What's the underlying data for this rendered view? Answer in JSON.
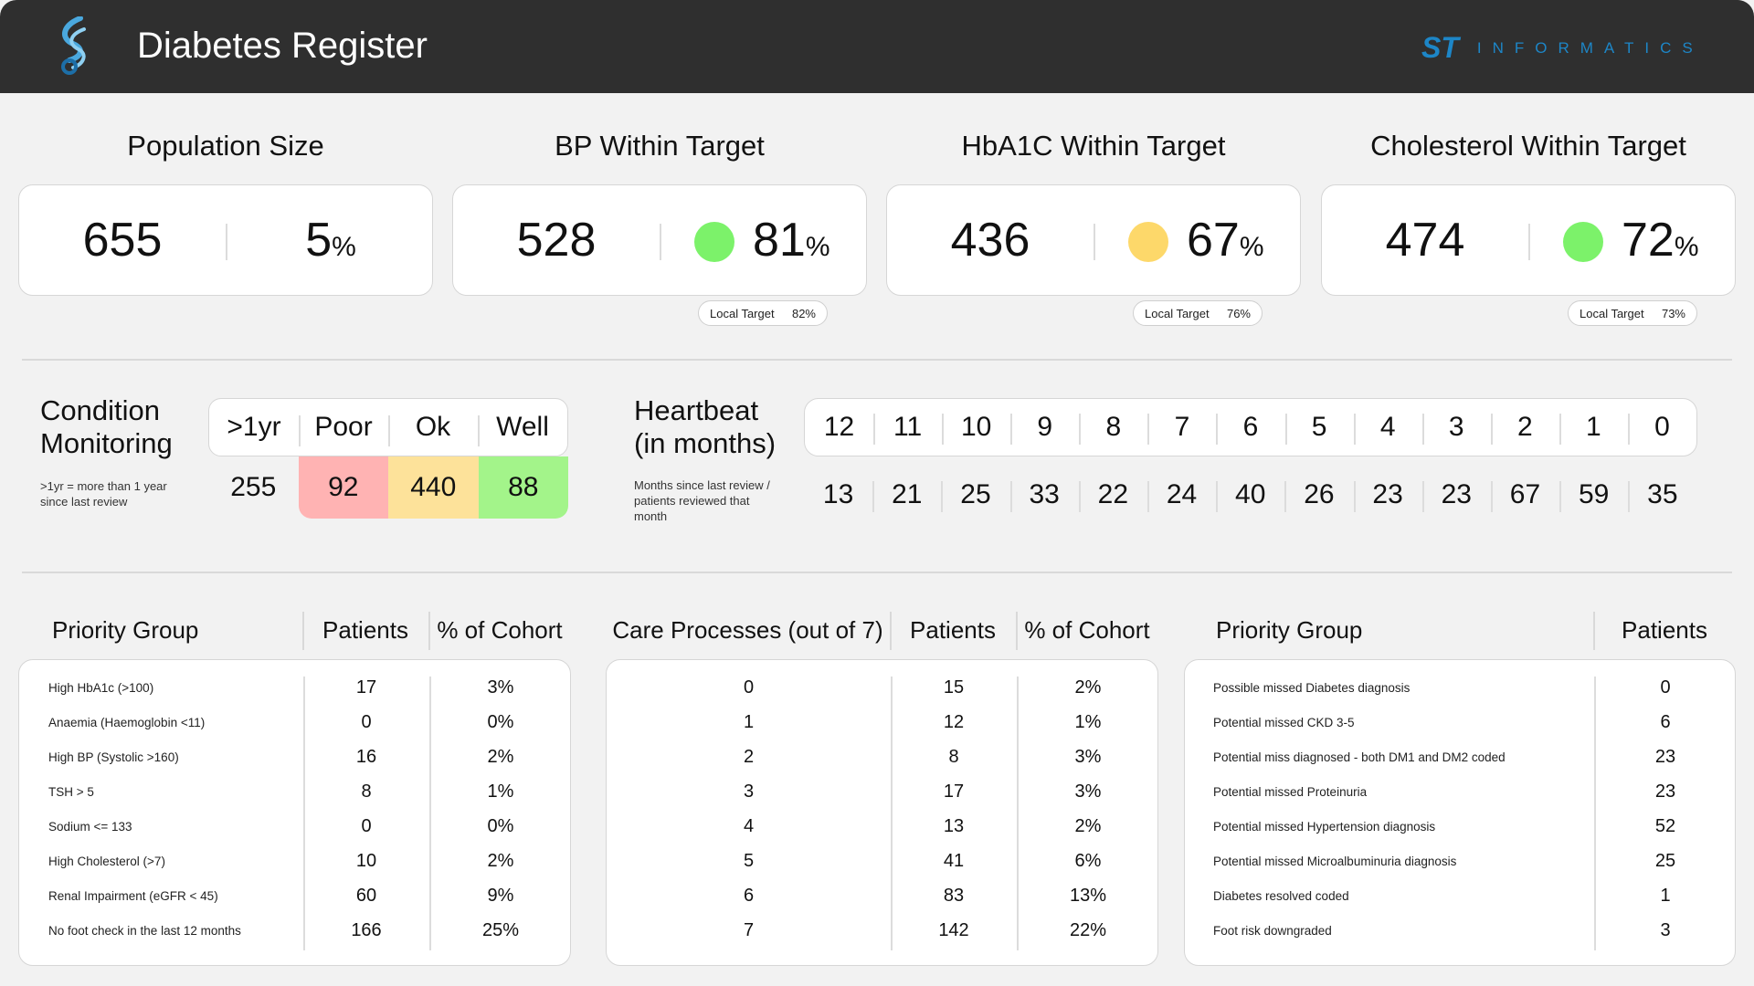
{
  "header": {
    "title": "Diabetes Register",
    "brand_st": "ST",
    "brand_name": "INFORMATICS"
  },
  "kpis": [
    {
      "title": "Population Size",
      "count": "655",
      "percent": "5",
      "unit": "%",
      "status_color": null,
      "local_target_label": null,
      "local_target": null
    },
    {
      "title": "BP Within Target",
      "count": "528",
      "percent": "81",
      "unit": "%",
      "status_color": "#7cf26a",
      "local_target_label": "Local Target",
      "local_target": "82%"
    },
    {
      "title": "HbA1C Within Target",
      "count": "436",
      "percent": "67",
      "unit": "%",
      "status_color": "#fdd86a",
      "local_target_label": "Local Target",
      "local_target": "76%"
    },
    {
      "title": "Cholesterol Within Target",
      "count": "474",
      "percent": "72",
      "unit": "%",
      "status_color": "#7cf26a",
      "local_target_label": "Local Target",
      "local_target": "73%"
    }
  ],
  "condition_monitoring": {
    "title_line1": "Condition",
    "title_line2": "Monitoring",
    "note": ">1yr = more than 1 year since last review",
    "columns": [
      {
        "label": ">1yr",
        "value": "255",
        "color": null
      },
      {
        "label": "Poor",
        "value": "92",
        "color": "#ffb3b3"
      },
      {
        "label": "Ok",
        "value": "440",
        "color": "#fde29a"
      },
      {
        "label": "Well",
        "value": "88",
        "color": "#a3f48a"
      }
    ]
  },
  "heartbeat": {
    "title_line1": "Heartbeat",
    "title_line2": "(in months)",
    "note": "Months since last review / patients reviewed that month",
    "months": [
      "12",
      "11",
      "10",
      "9",
      "8",
      "7",
      "6",
      "5",
      "4",
      "3",
      "2",
      "1",
      "0"
    ],
    "counts": [
      "13",
      "21",
      "25",
      "33",
      "22",
      "24",
      "40",
      "26",
      "23",
      "23",
      "67",
      "59",
      "35"
    ]
  },
  "priority_table": {
    "headers": [
      "Priority Group",
      "Patients",
      "% of Cohort"
    ],
    "rows": [
      [
        "High HbA1c (>100)",
        "17",
        "3%"
      ],
      [
        "Anaemia (Haemoglobin <11)",
        "0",
        "0%"
      ],
      [
        "High BP (Systolic >160)",
        "16",
        "2%"
      ],
      [
        "TSH > 5",
        "8",
        "1%"
      ],
      [
        "Sodium <= 133",
        "0",
        "0%"
      ],
      [
        "High Cholesterol (>7)",
        "10",
        "2%"
      ],
      [
        "Renal Impairment (eGFR < 45)",
        "60",
        "9%"
      ],
      [
        "No foot check in the last 12 months",
        "166",
        "25%"
      ]
    ]
  },
  "care_table": {
    "headers": [
      "Care Processes (out of 7)",
      "Patients",
      "% of Cohort"
    ],
    "rows": [
      [
        "0",
        "15",
        "2%"
      ],
      [
        "1",
        "12",
        "1%"
      ],
      [
        "2",
        "8",
        "3%"
      ],
      [
        "3",
        "17",
        "3%"
      ],
      [
        "4",
        "13",
        "2%"
      ],
      [
        "5",
        "41",
        "6%"
      ],
      [
        "6",
        "83",
        "13%"
      ],
      [
        "7",
        "142",
        "22%"
      ]
    ]
  },
  "missed_table": {
    "headers": [
      "Priority Group",
      "Patients"
    ],
    "rows": [
      [
        "Possible missed Diabetes diagnosis",
        "0"
      ],
      [
        "Potential missed CKD 3-5",
        "6"
      ],
      [
        "Potential miss diagnosed - both DM1 and DM2 coded",
        "23"
      ],
      [
        "Potential missed Proteinuria",
        "23"
      ],
      [
        "Potential missed Hypertension diagnosis",
        "52"
      ],
      [
        "Potential missed Microalbuminuria diagnosis",
        "25"
      ],
      [
        "Diabetes resolved coded",
        "1"
      ],
      [
        "Foot risk downgraded",
        "3"
      ]
    ]
  }
}
